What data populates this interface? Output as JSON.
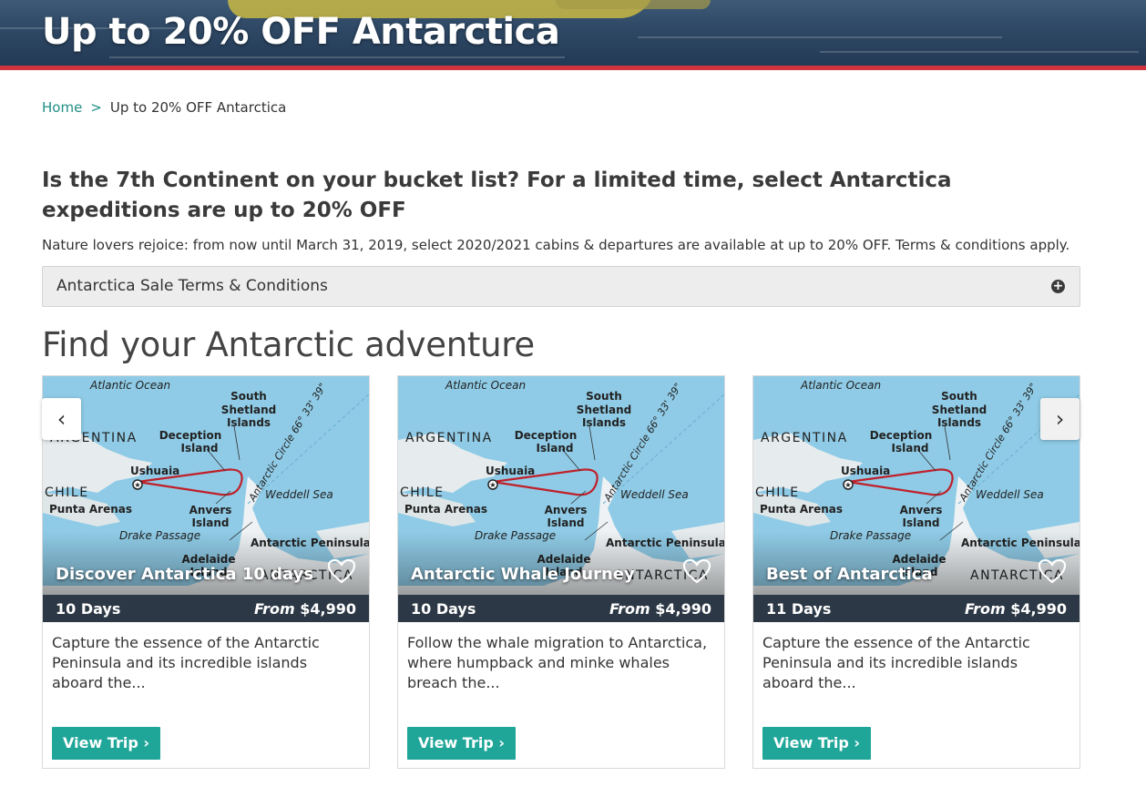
{
  "hero": {
    "title": "Up to 20% OFF Antarctica"
  },
  "breadcrumb": {
    "home": "Home",
    "separator": ">",
    "current": "Up to 20% OFF Antarctica"
  },
  "promo": {
    "heading": "Is the 7th Continent on your bucket list? For a limited time, select Antarctica expeditions are up to 20% OFF",
    "text": "Nature lovers rejoice: from now until March 31, 2019, select 2020/2021 cabins & departures are available at up to 20% OFF. Terms & conditions apply."
  },
  "terms": {
    "label": "Antarctica Sale Terms & Conditions",
    "icon": "plus-circle-icon"
  },
  "section_title": "Find your Antarctic adventure",
  "map_labels": {
    "atlantic": "Atlantic Ocean",
    "argentina": "ARGENTINA",
    "chile": "CHILE",
    "south_shetland": [
      "South",
      "Shetland",
      "Islands"
    ],
    "deception": [
      "Deception",
      "Island"
    ],
    "ushuaia": "Ushuaia",
    "punta_arenas": "Punta Arenas",
    "anvers": [
      "Anvers",
      "Island"
    ],
    "drake": "Drake Passage",
    "weddell": "Weddell Sea",
    "peninsula": "Antarctic Peninsula",
    "adelaide": [
      "Adelaide",
      "Island"
    ],
    "antarctica": "ANTARCTICA",
    "circle": "Antarctic Circle 66° 33' 39\""
  },
  "cards": [
    {
      "name": "Discover Antarctica 10 days",
      "days": "10 Days",
      "from": "From",
      "price": "$4,990",
      "description": "Capture the essence of the Antarctic Peninsula and its incredible islands aboard the...",
      "button": "View Trip ›"
    },
    {
      "name": "Antarctic Whale Journey",
      "days": "10 Days",
      "from": "From",
      "price": "$4,990",
      "description": "Follow the whale migration to Antarctica, where humpback and minke whales breach the...",
      "button": "View Trip ›"
    },
    {
      "name": "Best of Antarctica",
      "days": "11 Days",
      "from": "From",
      "price": "$4,990",
      "description": "Capture the essence of the Antarctic Peninsula and its incredible islands aboard the...",
      "button": "View Trip ›"
    }
  ],
  "carousel": {
    "prev": "‹",
    "next": "›"
  },
  "colors": {
    "accent": "#1fa699",
    "link": "#1f8f86",
    "stripe": "#d0343f",
    "bar": "#2c3845",
    "route": "#c0202a",
    "sea": "#8fcbe6"
  }
}
